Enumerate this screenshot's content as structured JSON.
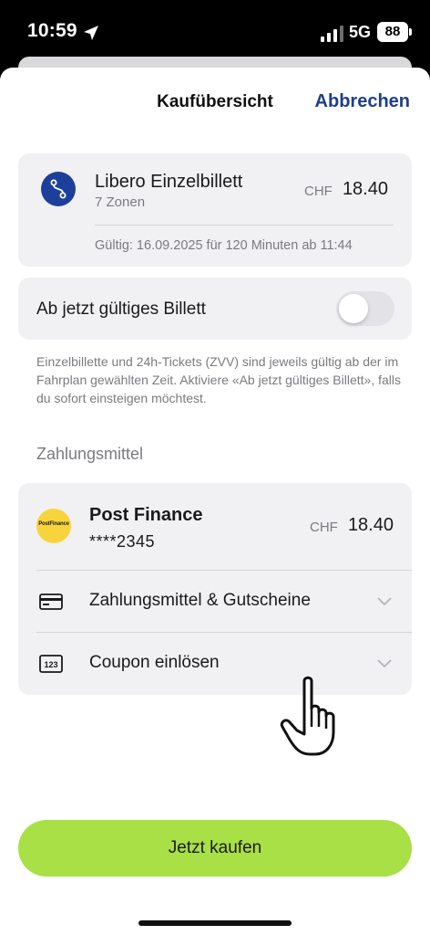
{
  "status_bar": {
    "time": "10:59",
    "network": "5G",
    "battery": "88"
  },
  "header": {
    "title": "Kaufübersicht",
    "cancel_label": "Abbrechen"
  },
  "ticket": {
    "name": "Libero Einzelbillett",
    "zones": "7 Zonen",
    "currency": "CHF",
    "price": "18.40",
    "validity": "Gültig: 16.09.2025 für 120 Minuten ab 11:44"
  },
  "immediate_toggle": {
    "label": "Ab jetzt gültiges Billett",
    "enabled": false
  },
  "info_text": "Einzelbillette und 24h-Tickets (ZVV) sind jeweils gültig ab der im Fahrplan gewählten Zeit. Aktiviere «Ab jetzt gültiges Billett», falls du sofort einsteigen möchtest.",
  "payment": {
    "section_title": "Zahlungsmittel",
    "method_name": "Post Finance",
    "logo_text": "PostFinance",
    "card_number": "****2345",
    "currency": "CHF",
    "price": "18.40",
    "rows": [
      {
        "label": "Zahlungsmittel & Gutscheine",
        "icon": "credit-card-icon"
      },
      {
        "label": "Coupon einlösen",
        "icon": "coupon-123-icon"
      }
    ]
  },
  "buy_button_label": "Jetzt kaufen",
  "colors": {
    "accent_blue": "#1d3f8c",
    "buy_green": "#a8e045",
    "postfinance_yellow": "#f8d43c",
    "card_bg": "#f1f1f4"
  }
}
